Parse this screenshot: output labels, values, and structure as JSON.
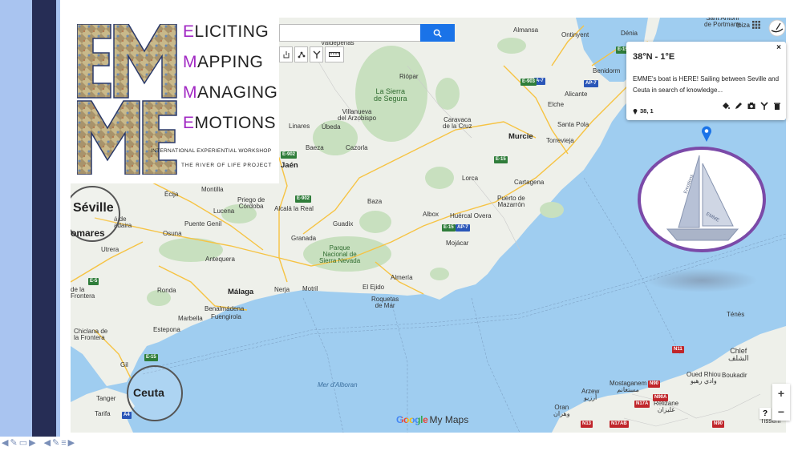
{
  "logo": {
    "words": [
      {
        "first": "E",
        "rest": "LICITING"
      },
      {
        "first": "M",
        "rest": "APPING"
      },
      {
        "first": "M",
        "rest": "ANAGING"
      },
      {
        "first": "E",
        "rest": "MOTIONS"
      }
    ],
    "subtitle1": "INTERNATIONAL EXPERIENTIAL WORKSHOP",
    "subtitle2": "THE RIVER OF LIFE PROJECT",
    "accent_color": "#a128c3"
  },
  "search": {
    "value": "",
    "icon": "search-icon"
  },
  "toolbar": {
    "icons": [
      "hand-icon",
      "marker-icon",
      "line-icon",
      "route-icon",
      "ruler-icon"
    ]
  },
  "map": {
    "places": [
      {
        "name": "Séville",
        "kind": "big"
      },
      {
        "name": "omares",
        "kind": "big"
      },
      {
        "name": "Ceuta",
        "kind": "big"
      },
      {
        "name": "Valdepeñas"
      },
      {
        "name": "Almansa"
      },
      {
        "name": "Ontinyent"
      },
      {
        "name": "Dénia"
      },
      {
        "name": "Benidorm"
      },
      {
        "name": "Alicante"
      },
      {
        "name": "Elche"
      },
      {
        "name": "Santa Pola"
      },
      {
        "name": "Torrevieja"
      },
      {
        "name": "Murcie",
        "kind": "major"
      },
      {
        "name": "Cartagena"
      },
      {
        "name": "Puerto de\nMazarrón"
      },
      {
        "name": "Lorca"
      },
      {
        "name": "Caravaca\nde la Cruz"
      },
      {
        "name": "Riópar"
      },
      {
        "name": "La Sierra\nde Segura",
        "kind": "green"
      },
      {
        "name": "Villanueva\ndel Arzobispo"
      },
      {
        "name": "Linares"
      },
      {
        "name": "Úbeda"
      },
      {
        "name": "Baeza"
      },
      {
        "name": "Cazorla"
      },
      {
        "name": "Jaén"
      },
      {
        "name": "Montilla"
      },
      {
        "name": "Écija"
      },
      {
        "name": "Lucena"
      },
      {
        "name": "Priego de\nCórdoba"
      },
      {
        "name": "Alcalá la Real"
      },
      {
        "name": "Baza"
      },
      {
        "name": "Guadix"
      },
      {
        "name": "Albox"
      },
      {
        "name": "Huércal Overa"
      },
      {
        "name": "Mojácar"
      },
      {
        "name": "Puente Genil"
      },
      {
        "name": "Osuna"
      },
      {
        "name": "Utrera"
      },
      {
        "name": "Antequera"
      },
      {
        "name": "Granada"
      },
      {
        "name": "Parque\nNacional de\nSierra Nevada",
        "kind": "green"
      },
      {
        "name": "Ronda"
      },
      {
        "name": "Málaga",
        "kind": "major"
      },
      {
        "name": "Benalmádena"
      },
      {
        "name": "Fuengirola"
      },
      {
        "name": "Marbella"
      },
      {
        "name": "Estepona"
      },
      {
        "name": "Nerja"
      },
      {
        "name": "Motril"
      },
      {
        "name": "El Ejido"
      },
      {
        "name": "Almería"
      },
      {
        "name": "Roquetas\nde Mar"
      },
      {
        "name": "Chiclana de\nla Frontera"
      },
      {
        "name": "Tarifa"
      },
      {
        "name": "Tanger"
      },
      {
        "name": "Mer d'Alboran",
        "kind": "sea"
      },
      {
        "name": "Oran\nوهران"
      },
      {
        "name": "Arzew\nأرزيو"
      },
      {
        "name": "Mostaganem\nمستغانم"
      },
      {
        "name": "Relizane\nغليزان"
      },
      {
        "name": "Oued Rhiou\nوادي رهيو"
      },
      {
        "name": "Chlef\nالشلف"
      },
      {
        "name": "Boukadir"
      },
      {
        "name": "Ténès"
      },
      {
        "name": "Tissem"
      },
      {
        "name": "Ibiza"
      },
      {
        "name": "Sant Antoni\nde Portmany"
      },
      {
        "name": "Gil"
      },
      {
        "name": "á de\nadaira"
      },
      {
        "name": "de la\nFrontera"
      }
    ],
    "road_shields": [
      "E-5",
      "E-902",
      "E-902",
      "A-7",
      "E-15",
      "E-903",
      "AP-7",
      "E-15",
      "E-15",
      "AP-7",
      "E-15",
      "A4",
      "N11",
      "N90",
      "N17A",
      "N90A",
      "N13",
      "N17AB",
      "N90"
    ]
  },
  "popup": {
    "title": "38°N - 1°E",
    "close": "×",
    "description": "EMME's boat is HERE! Sailing between Seville and Ceuta in search of knowledge...",
    "coords": "38, 1",
    "tools": [
      "style-icon",
      "edit-icon",
      "camera-icon",
      "route-icon",
      "trash-icon"
    ]
  },
  "boat": {
    "border_color": "#7b4aa8"
  },
  "controls": {
    "zoom_in": "+",
    "zoom_out": "−",
    "help": "?"
  },
  "branding": {
    "google": "Google",
    "my_maps": "My Maps"
  },
  "bottom_nav": {
    "icons": [
      "prev-icon",
      "pen-icon",
      "slide-icon",
      "next-icon",
      "prev-icon",
      "pen-icon",
      "menu-icon",
      "next-icon"
    ]
  }
}
